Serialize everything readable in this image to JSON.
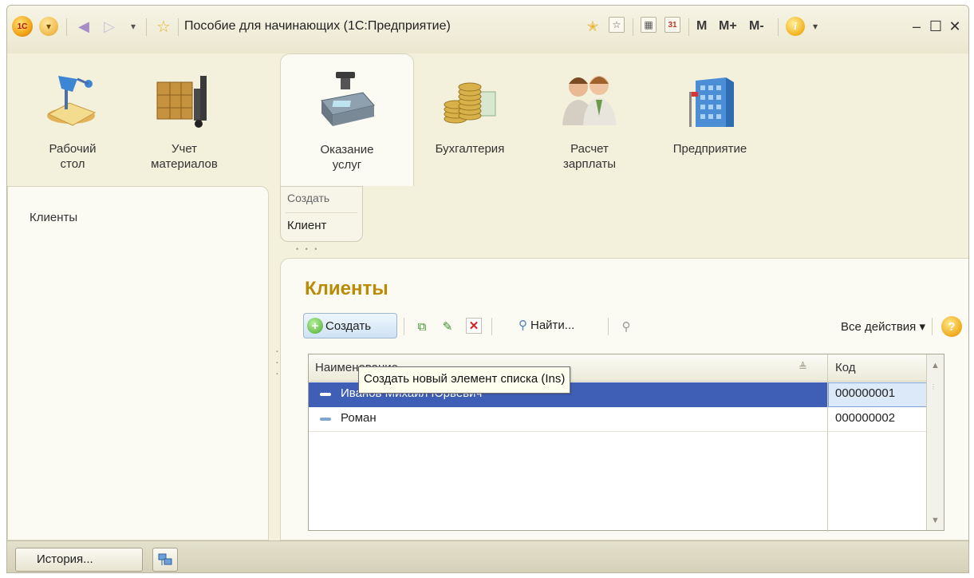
{
  "window": {
    "title": "Пособие для начинающих  (1С:Предприятие)",
    "logo_text": "1С",
    "m_label": "M",
    "mplus_label": "M+",
    "mminus_label": "M-"
  },
  "sections": [
    {
      "label": "Рабочий\nстол",
      "icon": "desk-lamp-icon"
    },
    {
      "label": "Учет\nматериалов",
      "icon": "boxes-icon"
    },
    {
      "label": "Оказание\nуслуг",
      "icon": "cash-register-icon",
      "active": true
    },
    {
      "label": "Бухгалтерия",
      "icon": "coins-icon"
    },
    {
      "label": "Расчет\nзарплаты",
      "icon": "people-icon"
    },
    {
      "label": "Предприятие",
      "icon": "building-icon"
    }
  ],
  "navigation": {
    "items": [
      "Клиенты"
    ]
  },
  "create_panel": {
    "header": "Создать",
    "items": [
      "Клиент"
    ]
  },
  "form": {
    "title": "Клиенты",
    "toolbar": {
      "create_label": "Создать",
      "find_label": "Найти...",
      "all_actions_label": "Все действия ▾",
      "help_label": "?"
    },
    "table": {
      "columns": [
        "Наименование",
        "Код"
      ],
      "rows": [
        {
          "name": "Иванов Михаил Юрьевич",
          "code": "000000001",
          "selected": true
        },
        {
          "name": "Роман",
          "code": "000000002",
          "selected": false
        }
      ]
    },
    "tooltip": "Создать новый элемент списка (Ins)"
  },
  "bottom": {
    "history_label": "История..."
  },
  "colors": {
    "title_accent": "#b98b07",
    "selection": "#3f5fb6",
    "background": "#f3f0dc"
  }
}
